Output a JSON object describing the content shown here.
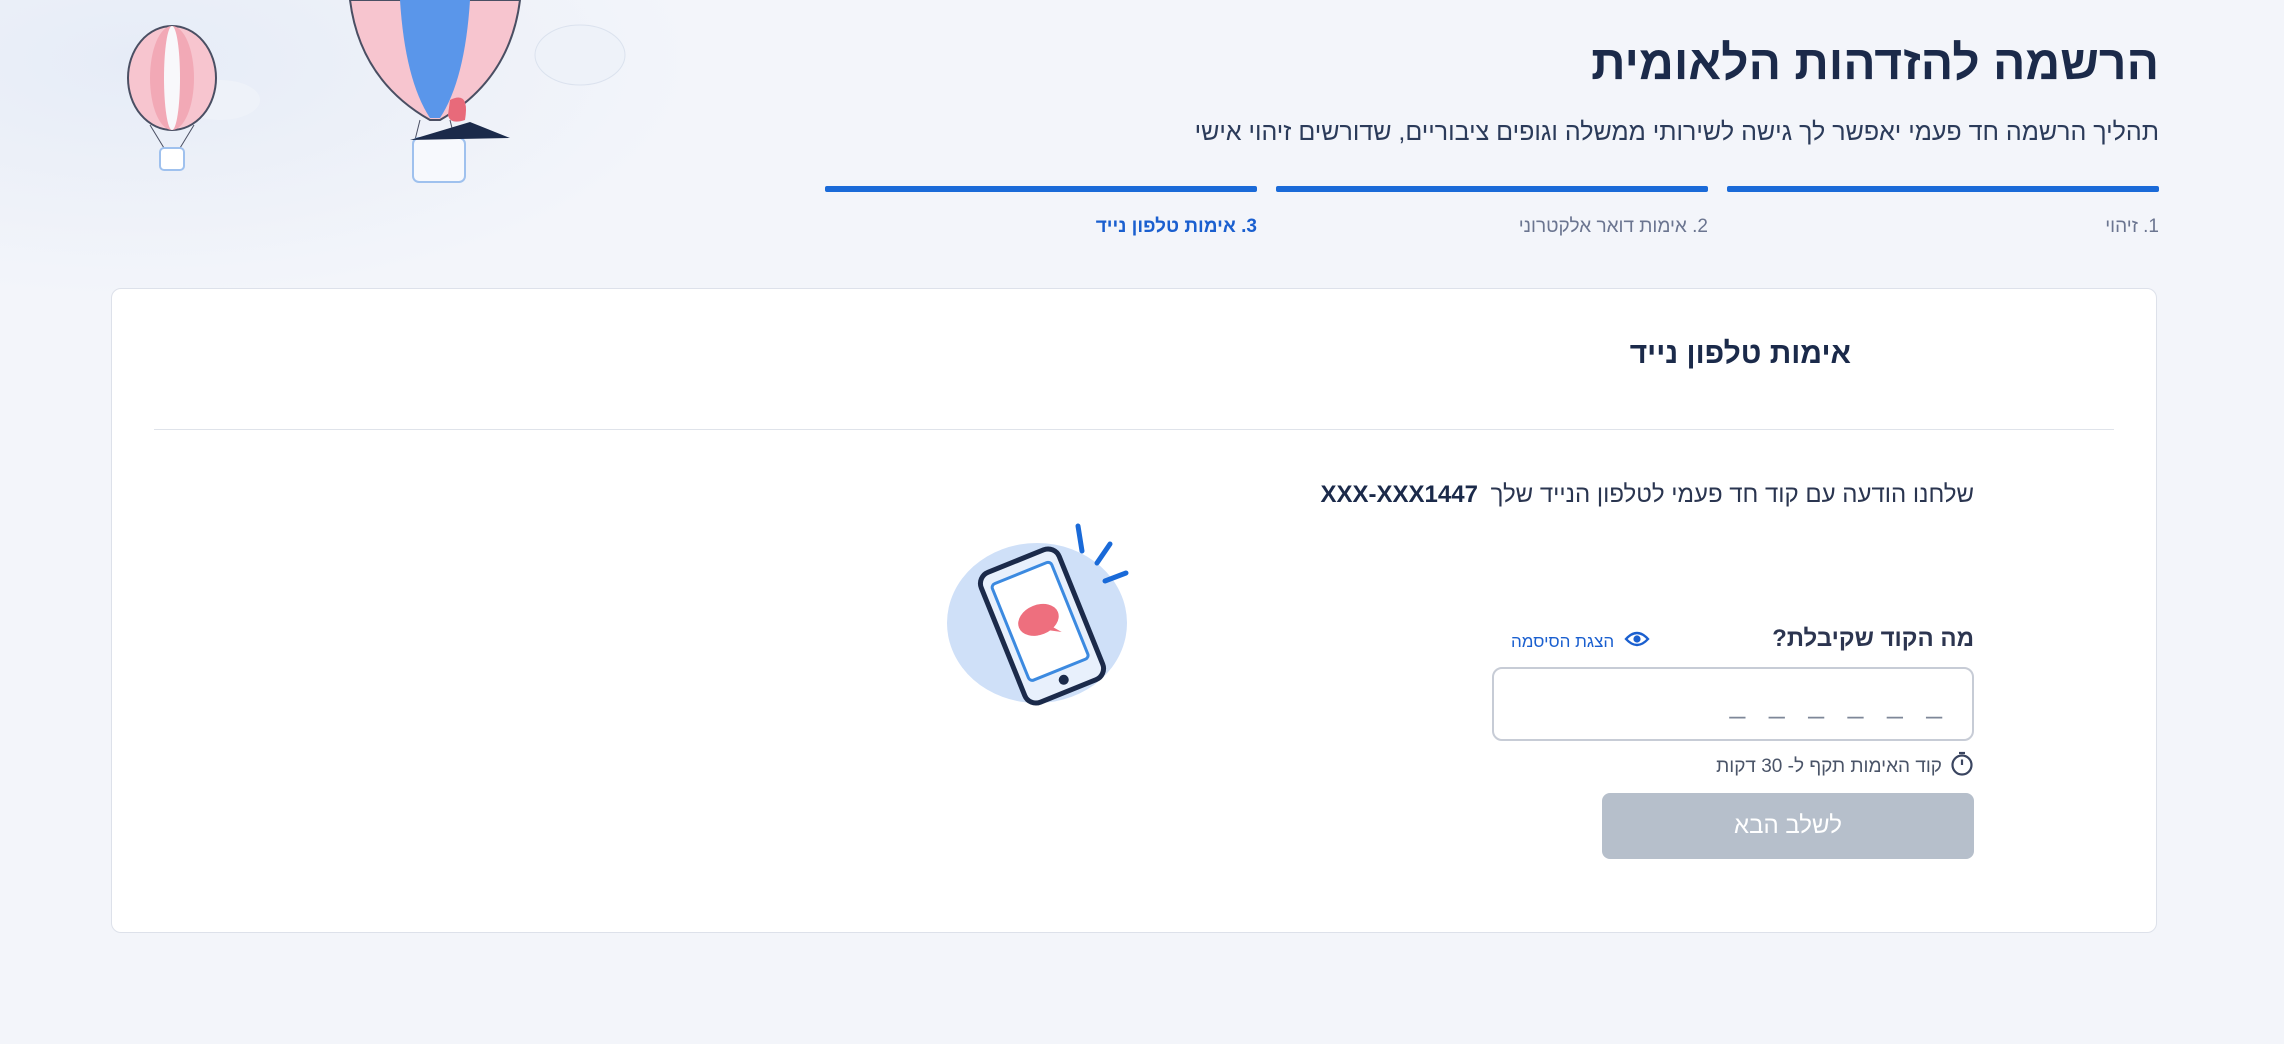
{
  "header": {
    "title": "הרשמה להזדהות הלאומית",
    "subtitle": "תהליך הרשמה חד פעמי יאפשר לך גישה לשירותי ממשלה וגופים ציבוריים, שדורשים זיהוי אישי"
  },
  "stepper": {
    "steps": [
      {
        "label": "1. זיהוי",
        "state": "done"
      },
      {
        "label": "2. אימות דואר אלקטרוני",
        "state": "done"
      },
      {
        "label": "3. אימות טלפון נייד",
        "state": "active"
      }
    ]
  },
  "card": {
    "title": "אימות טלפון נייד",
    "message": "שלחנו הודעה עם קוד חד פעמי לטלפון הנייד שלך",
    "phone": "XXX-XXX1447",
    "code_label": "מה הקוד שקיבלת?",
    "show_password_label": "הצגת הסיסמה",
    "code_placeholder": "_ _ _ _ _ _",
    "validity_text": "קוד האימות תקף ל- 30 דקות",
    "next_button": "לשלב הבא"
  },
  "icons": {
    "show_password": "eye-icon",
    "validity": "stopwatch-icon",
    "illustration": "phone-message-illustration",
    "decor": "hot-air-balloons"
  },
  "colors": {
    "accent": "#1a6ad8",
    "disabled_button": "#b6bfcb",
    "background": "#f3f5fa"
  }
}
